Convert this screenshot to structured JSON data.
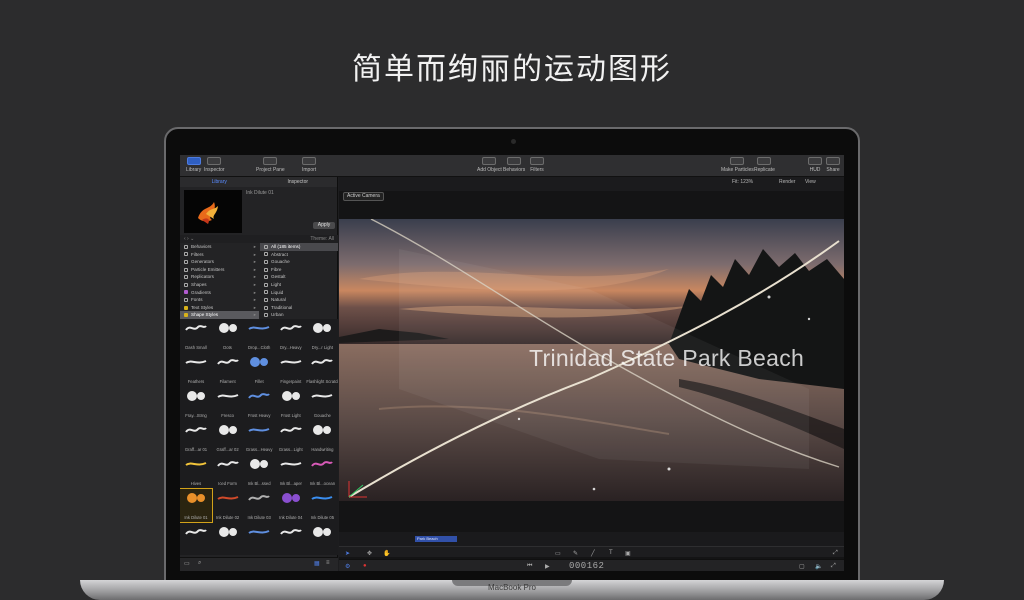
{
  "headline": "简单而绚丽的运动图形",
  "laptop_brand": "MacBook Pro",
  "toolbar": {
    "left": [
      {
        "label": "Library"
      },
      {
        "label": "Inspector"
      }
    ],
    "project_pane": "Project Pane",
    "import": "Import",
    "add_object": "Add Object",
    "behaviors": "Behaviors",
    "filters": "Filters",
    "make_particles": "Make Particles",
    "replicate": "Replicate",
    "hud": "HUD",
    "share": "Share"
  },
  "sidebar": {
    "tab_library": "Library",
    "tab_inspector": "Inspector",
    "preview_name": "Ink Dilute 01",
    "apply": "Apply",
    "theme_label": "Theme: All",
    "categories": [
      "Behaviors",
      "Filters",
      "Generators",
      "Particle Emitters",
      "Replicators",
      "Shapes",
      "Gradients",
      "Fonts",
      "Text Styles",
      "Shape Styles"
    ],
    "subcategories": [
      "All (185 items)",
      "Abstract",
      "Gouache",
      "Fibre",
      "Gestalt",
      "Light",
      "Liquid",
      "Natural",
      "Traditional",
      "Urban"
    ],
    "grid_labels": [
      "Dash Small",
      "Dots",
      "Drop...Cloth",
      "Dry...Heavy",
      "Dry...r Light",
      "Feathers",
      "Filament",
      "Fillet",
      "Fingerpaint",
      "Flashlight Scratch",
      "Fray...Strng",
      "Fresco",
      "Frost Heavy",
      "Frost Light",
      "Gouache",
      "Graff...ar 01",
      "Graff...ar 02",
      "Grass...Heavy",
      "Grass...Light",
      "Handwriting",
      "Hives",
      "Iced Form",
      "Ink Bl...ssed",
      "Ink Bl...aper",
      "Ink Bl...ocean",
      "Ink Dilute 01",
      "Ink Dilute 02",
      "Ink Dilute 03",
      "Ink Dilute 04",
      "Ink Dilute 05",
      "",
      "",
      "",
      "",
      ""
    ]
  },
  "viewer": {
    "fit": "Fit: 123%",
    "render": "Render",
    "view": "View",
    "camera": "Active Camera",
    "title_text": "Trinidad State Park Beach",
    "clip_label": "Park Beach",
    "timecode": "000162"
  },
  "colors": {
    "accent": "#3f6fe0",
    "selection_highlight": "#d2a21a"
  }
}
